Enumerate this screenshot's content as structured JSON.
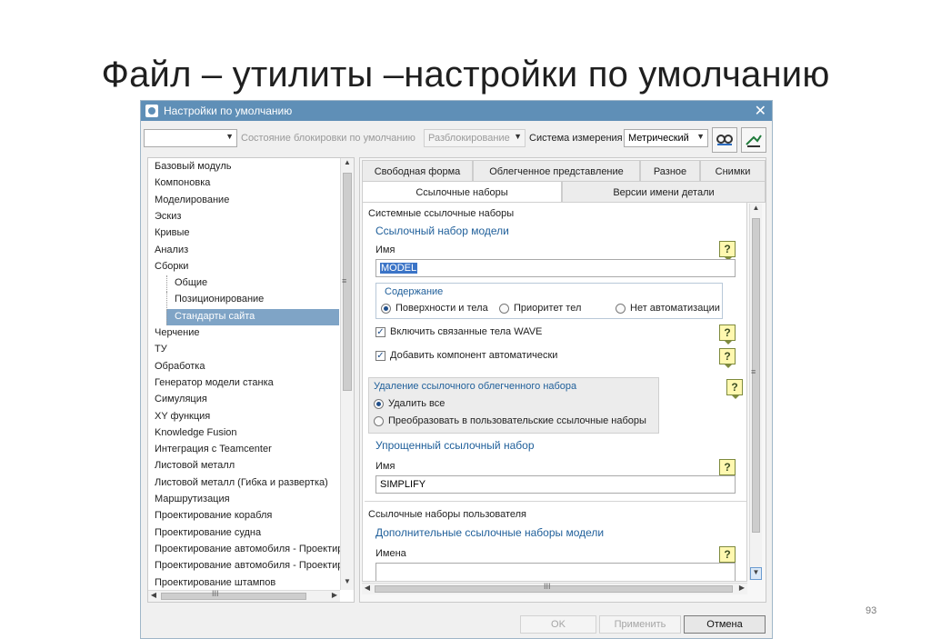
{
  "slide": {
    "title": "Файл – утилиты –настройки по умолчанию",
    "page_number": "93"
  },
  "dialog": {
    "title": "Настройки по умолчанию",
    "close_glyph": "✕",
    "toolbar": {
      "scope_combo_value": "",
      "lock_state_label": "Состояние блокировки по умолчанию",
      "lock_combo_value": "Разблокирование",
      "units_label": "Система измерения",
      "units_combo_value": "Метрический",
      "import_icon": "import-icon",
      "export_icon": "export-icon"
    },
    "tree": {
      "items": [
        "Базовый модуль",
        "Компоновка",
        "Моделирование",
        "Эскиз",
        "Кривые",
        "Анализ",
        "Сборки",
        "Общие",
        "Позиционирование",
        "Стандарты сайта",
        "Черчение",
        "ТУ",
        "Обработка",
        "Генератор модели станка",
        "Симуляция",
        "XY функция",
        "Knowledge Fusion",
        "Интеграция с Teamcenter",
        "Листовой металл",
        "Листовой металл (Гибка и развертка)",
        "Маршрутизация",
        "Проектирование корабля",
        "Проектирование судна",
        "Проектирование автомобиля - Проектир",
        "Проектирование автомобиля - Проектир",
        "Проектирование штампов"
      ],
      "selected": "Стандарты сайта"
    },
    "tabs": {
      "row1": [
        "Свободная форма",
        "Облегченное представление",
        "Разное",
        "Снимки"
      ],
      "row2": [
        "Ссылочные наборы",
        "Версии имени детали"
      ],
      "active": "Ссылочные наборы"
    },
    "panel": {
      "system_sets_title": "Системные ссылочные наборы",
      "model_set_title": "Ссылочный набор модели",
      "name_label": "Имя",
      "model_name_value": "MODEL",
      "content_title": "Содержание",
      "content_options": [
        "Поверхности и тела",
        "Приоритет тел",
        "Нет автоматизации"
      ],
      "content_selected": "Поверхности и тела",
      "wave_checkbox": "Включить связанные тела WAVE",
      "auto_component_checkbox": "Добавить компонент автоматически",
      "delete_title": "Удаление ссылочного облегченного набора",
      "delete_options": [
        "Удалить все",
        "Преобразовать в пользовательские ссылочные наборы"
      ],
      "delete_selected": "Удалить все",
      "simplified_title": "Упрощенный ссылочный набор",
      "simplified_name_label": "Имя",
      "simplified_name_value": "SIMPLIFY",
      "user_sets_title": "Ссылочные наборы пользователя",
      "additional_title": "Дополнительные ссылочные наборы модели",
      "names_label": "Имена",
      "help_glyph": "?"
    },
    "scroll": {
      "grip": "≡",
      "hgrip": "III"
    },
    "buttons": {
      "ok": "OK",
      "apply": "Применить",
      "cancel": "Отмена"
    },
    "colors": {
      "titlebar": "#5f8fb7",
      "selection": "#7fa4c6",
      "group_title": "#1f5f9a"
    }
  }
}
